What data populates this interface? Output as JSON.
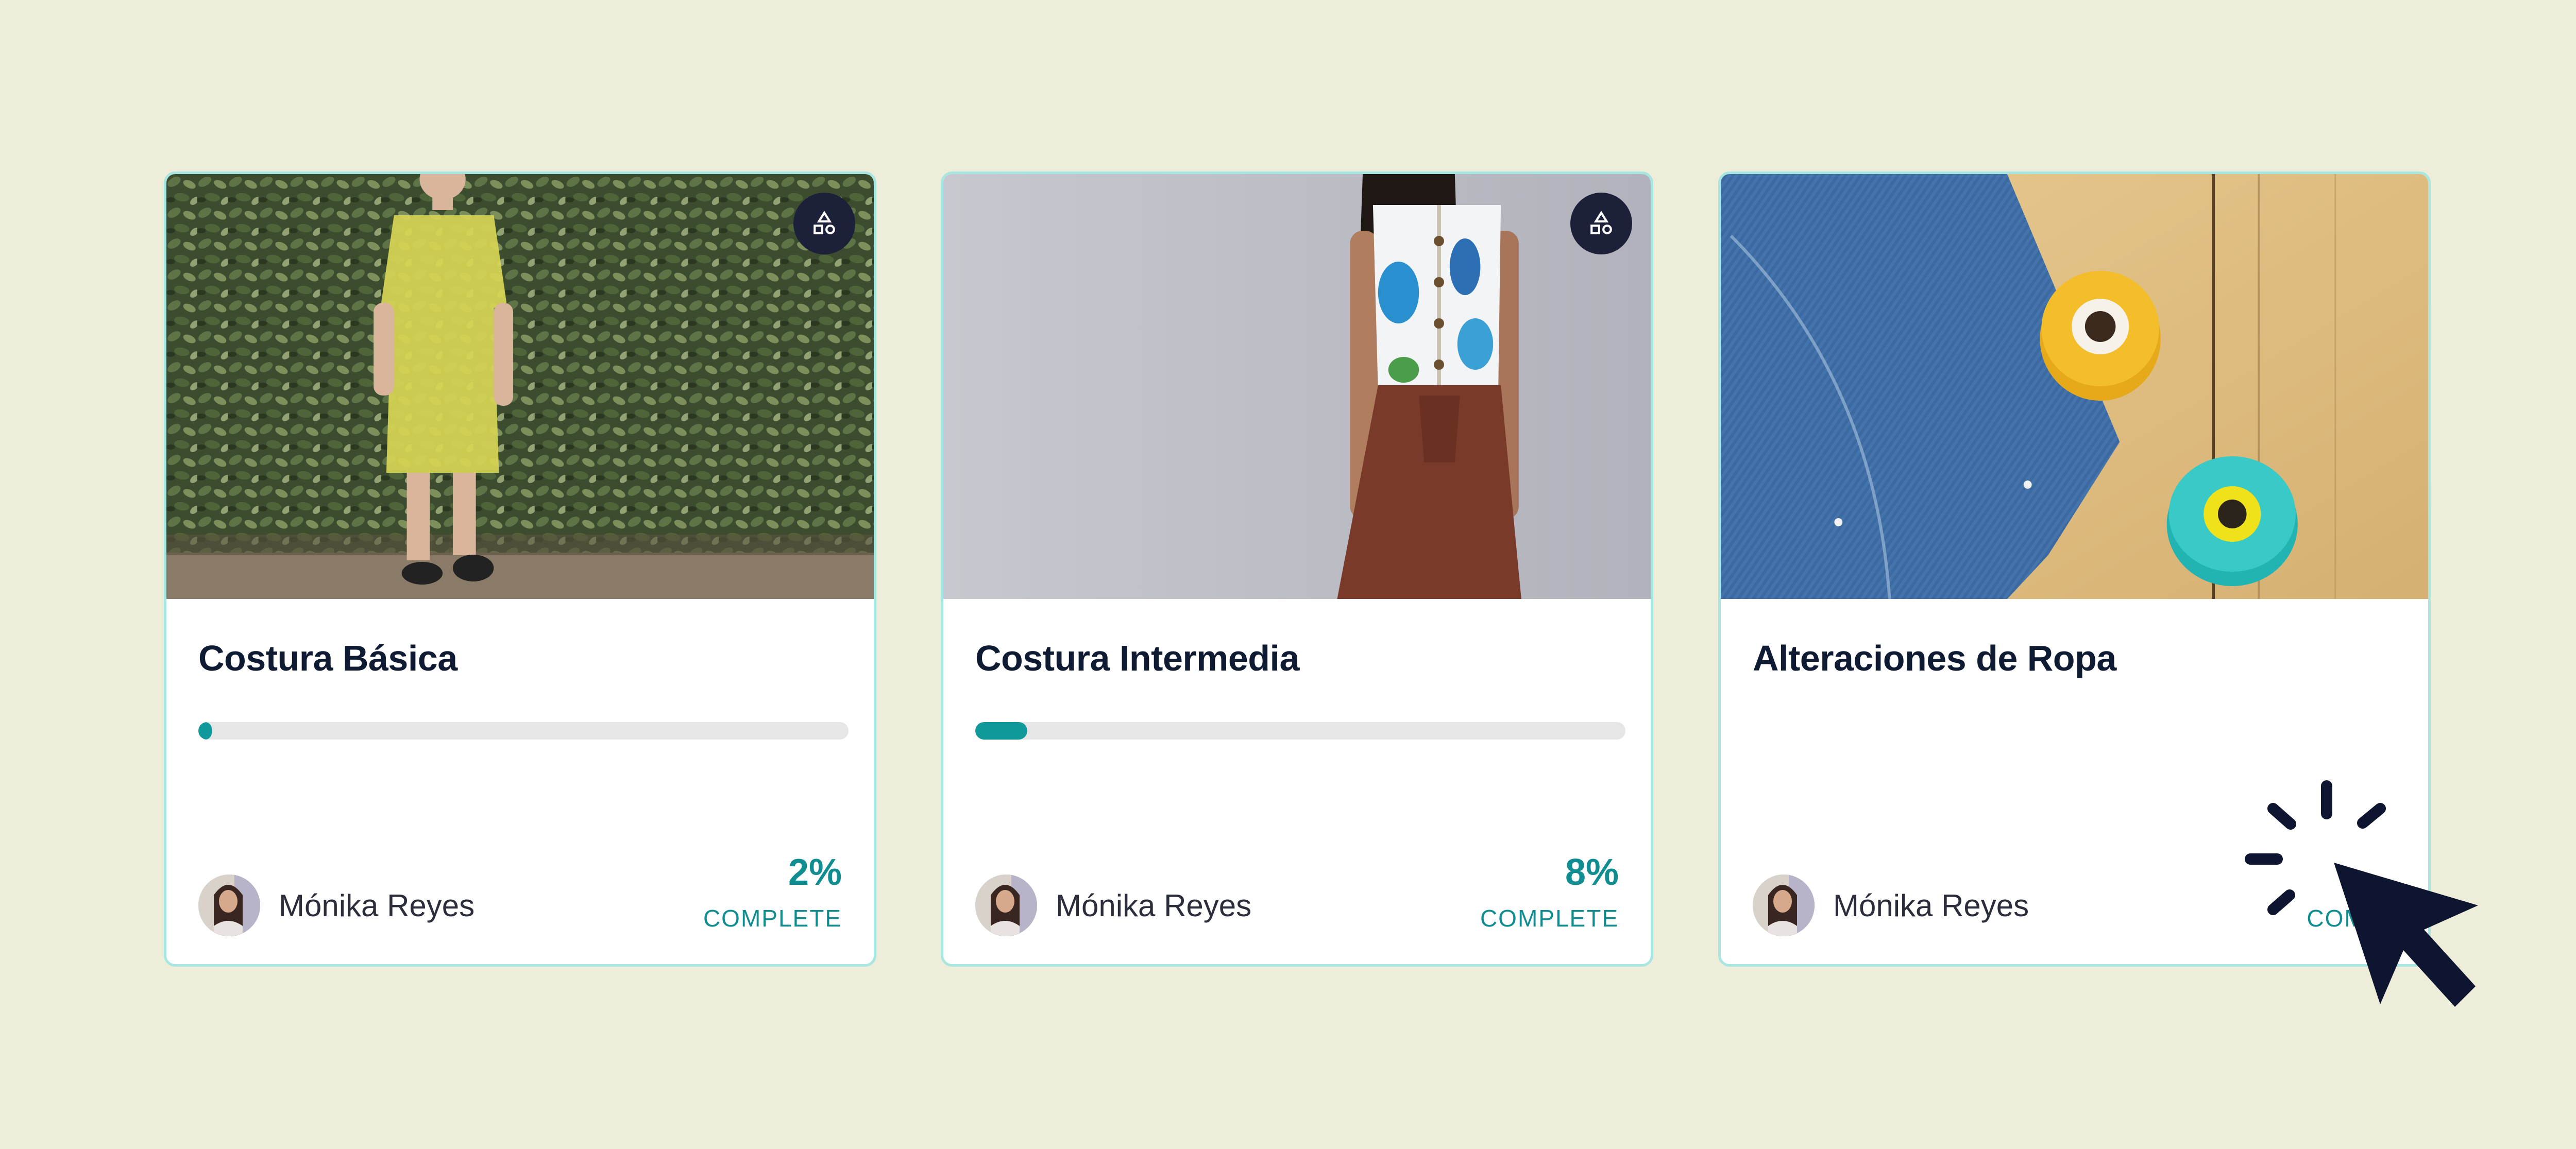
{
  "colors": {
    "background": "#eeedda",
    "card_border": "#a8e6e2",
    "accent": "#0f999b",
    "title": "#0f1b33",
    "badge": "#1c2039",
    "cursor": "#0d1530"
  },
  "courses": [
    {
      "title": "Costura Básica",
      "progress": 2,
      "percent_label": "2%",
      "complete_label": "COMPLETE",
      "author": "Mónika Reyes",
      "badge_icon": "shapes-icon",
      "image": "woman-yellow-dress-hedge"
    },
    {
      "title": "Costura Intermedia",
      "progress": 8,
      "percent_label": "8%",
      "complete_label": "COMPLETE",
      "author": "Mónika Reyes",
      "badge_icon": "shapes-icon",
      "image": "woman-floral-top-brown-pants"
    },
    {
      "title": "Alteraciones de Ropa",
      "author": "Mónika Reyes",
      "complete_label": "COMPL",
      "image": "jeans-thread-spools"
    }
  ],
  "overlay": {
    "icons": [
      "loading-spinner-icon",
      "cursor-arrow-icon"
    ]
  }
}
